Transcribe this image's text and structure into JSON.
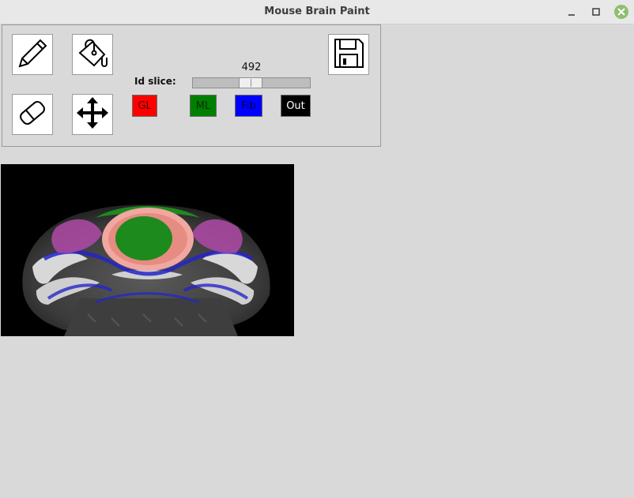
{
  "window": {
    "title": "Mouse Brain Paint"
  },
  "toolbar": {
    "tools": [
      {
        "name": "pencil",
        "icon": "pencil-icon"
      },
      {
        "name": "fill",
        "icon": "paint-bucket-icon"
      },
      {
        "name": "eraser",
        "icon": "eraser-icon"
      },
      {
        "name": "move",
        "icon": "move-arrows-icon"
      },
      {
        "name": "save",
        "icon": "floppy-disk-icon"
      }
    ],
    "slice_label": "Id slice:",
    "slice_value": "492",
    "slider_fraction": 0.48
  },
  "labels": [
    {
      "text": "GL",
      "bg": "#ff0000",
      "fg": "#4a0000"
    },
    {
      "text": "ML",
      "bg": "#008000",
      "fg": "#0b2b0b"
    },
    {
      "text": "Fib",
      "bg": "#0000ff",
      "fg": "#00004a"
    },
    {
      "text": "Out",
      "bg": "#000000",
      "fg": "#ffffff"
    }
  ]
}
